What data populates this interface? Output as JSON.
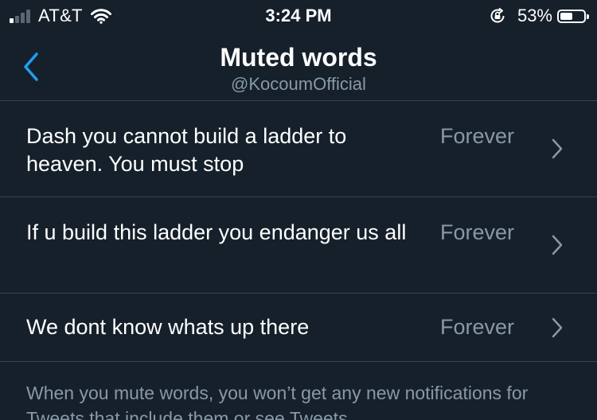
{
  "status_bar": {
    "carrier": "AT&T",
    "time": "3:24 PM",
    "battery_percent_label": "53%",
    "battery_level": 0.53,
    "signal_bars_active": 1,
    "signal_bars_total": 4,
    "icons": [
      "signal-icon",
      "wifi-icon",
      "rotation-lock-icon",
      "battery-icon"
    ]
  },
  "header": {
    "title": "Muted words",
    "subtitle": "@KocoumOfficial",
    "back_icon": "chevron-left-icon"
  },
  "muted_words": [
    {
      "text": "Dash you cannot build a ladder to heaven. You must stop",
      "duration": "Forever"
    },
    {
      "text": "If u build this ladder you endanger us all",
      "duration": "Forever"
    },
    {
      "text": "We dont know whats up there",
      "duration": "Forever"
    }
  ],
  "footer_note": "When you mute words, you won’t get any new notifications for Tweets that include them or see Tweets",
  "colors": {
    "background": "#15202b",
    "divider": "#38444d",
    "secondary_text": "#8899a6",
    "accent": "#1da1f2",
    "primary_text": "#ffffff"
  }
}
